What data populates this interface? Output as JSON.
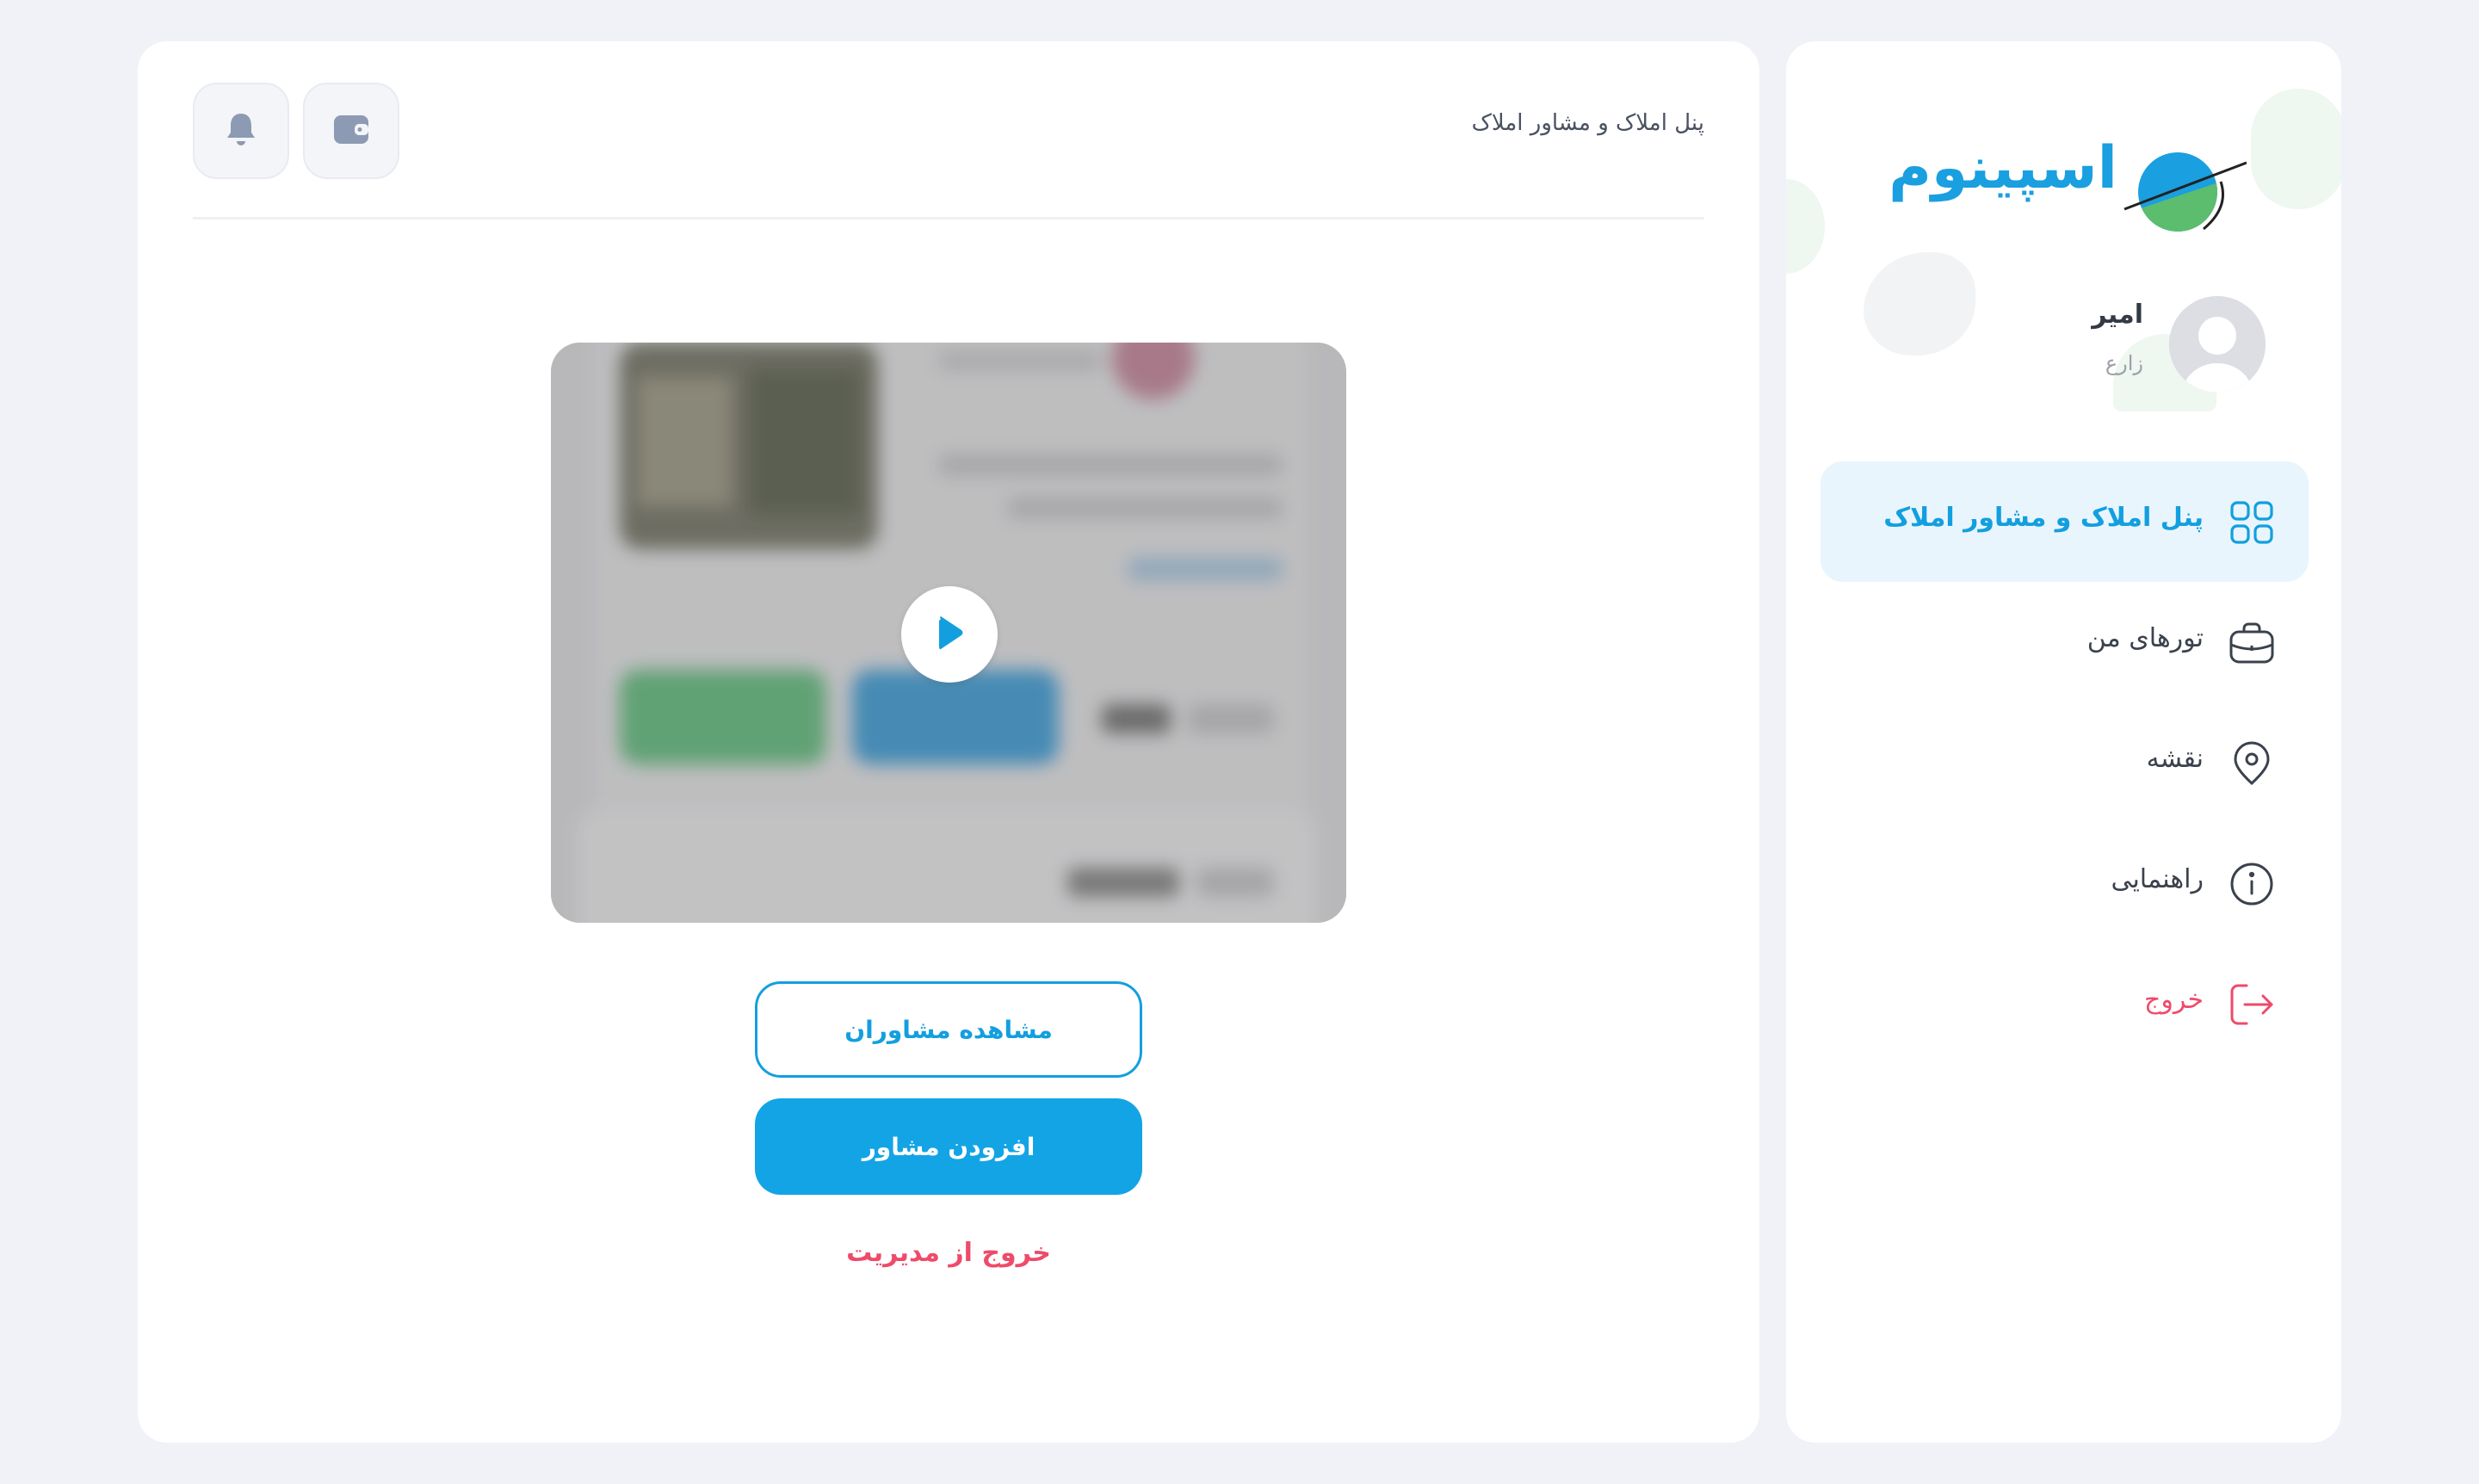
{
  "sidebar": {
    "logo_text": "اسپینوم",
    "user": {
      "name": "امیر",
      "role": "زارع"
    },
    "items": [
      {
        "label": "پنل املاک و مشاور املاک",
        "icon": "grid-icon",
        "active": true
      },
      {
        "label": "تورهای من",
        "icon": "briefcase-icon",
        "active": false
      },
      {
        "label": "نقشه",
        "icon": "map-pin-icon",
        "active": false
      },
      {
        "label": "راهنمایی",
        "icon": "info-icon",
        "active": false
      },
      {
        "label": "خروج",
        "icon": "logout-icon",
        "active": false
      }
    ]
  },
  "header": {
    "title": "پنل املاک و مشاور املاک",
    "wallet_icon": "wallet-icon",
    "bell_icon": "bell-icon"
  },
  "main": {
    "video_play_icon": "play-icon",
    "view_advisors_label": "مشاهده مشاوران",
    "add_advisor_label": "افزودن مشاور",
    "exit_management_label": "خروج از مدیریت"
  },
  "colors": {
    "accent": "#139fdf",
    "danger": "#ee4b6a",
    "active_bg": "#e9f5fd",
    "page_bg": "#f1f2f7"
  }
}
